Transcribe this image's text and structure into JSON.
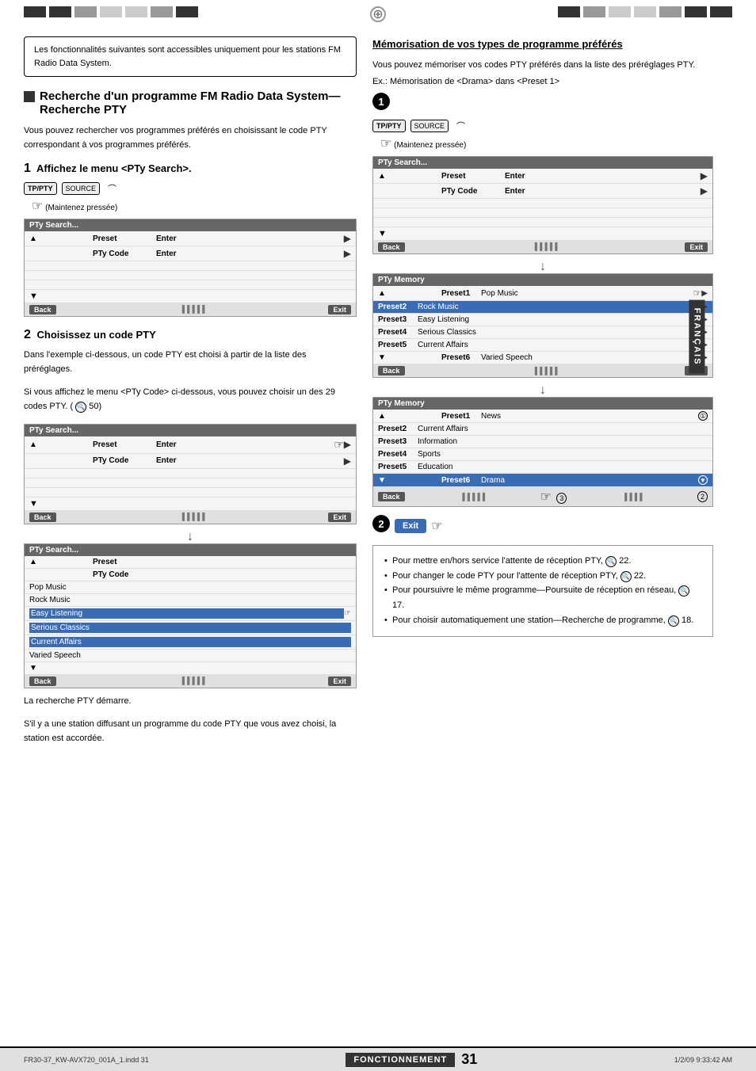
{
  "page": {
    "number": "31",
    "file": "FR30-37_KW-AVX720_001A_1.indd  31",
    "date": "1/2/09  9:33:42 AM",
    "fonctionnement": "FONCTIONNEMENT",
    "francais": "FRANÇAIS"
  },
  "notice": {
    "text": "Les fonctionnalités suivantes sont accessibles uniquement pour les stations FM Radio Data System."
  },
  "left": {
    "section_title": "Recherche d'un programme FM Radio Data System—Recherche PTY",
    "section_desc": "Vous pouvez rechercher vos programmes préférés en choisissant le code PTY correspondant à vos programmes préférés.",
    "step1": {
      "header": "Affichez le menu <PTy Search>.",
      "instruction_label": "(Maintenez pressée)"
    },
    "step2_header": "Choisissez un code PTY",
    "step2_desc1": "Dans l'exemple ci-dessous, un code PTY est choisi à partir de la liste des préréglages.",
    "step2_desc2": "Si vous affichez le menu <PTy Code> ci-dessous, vous pouvez choisir un des 29 codes PTY. (",
    "step2_ref": "50)",
    "result_text1": "La recherche PTY démarre.",
    "result_text2": "S'il y a une station diffusant un programme du code PTY que vous avez choisi, la station est accordée."
  },
  "panels": {
    "pty_search_title": "PTy Search...",
    "pty_memory_title": "PTy Memory",
    "preset_label": "Preset",
    "pty_code_label": "PTy Code",
    "enter_label": "Enter",
    "back_label": "Back",
    "exit_label": "Exit",
    "presets_list1": [
      {
        "name": "Preset1",
        "value": "Pop Music",
        "highlighted": false
      },
      {
        "name": "Preset2",
        "value": "Rock Music",
        "highlighted": false
      },
      {
        "name": "Preset3",
        "value": "Easy Listening",
        "highlighted": true
      },
      {
        "name": "Preset4",
        "value": "Serious Classics",
        "highlighted": false
      },
      {
        "name": "Preset5",
        "value": "Current Affairs",
        "highlighted": false
      },
      {
        "name": "Preset6",
        "value": "Varied Speech",
        "highlighted": false
      }
    ],
    "presets_list2": [
      {
        "name": "Preset1",
        "value": "News",
        "highlighted": false
      },
      {
        "name": "Preset2",
        "value": "Current Affairs",
        "highlighted": false
      },
      {
        "name": "Preset3",
        "value": "Information",
        "highlighted": false
      },
      {
        "name": "Preset4",
        "value": "Sports",
        "highlighted": false
      },
      {
        "name": "Preset5",
        "value": "Education",
        "highlighted": false
      },
      {
        "name": "Preset6",
        "value": "Drama",
        "highlighted": true
      }
    ],
    "pty_search_items": [
      {
        "value": "Pop Music",
        "highlighted": false
      },
      {
        "value": "Rock Music",
        "highlighted": false
      },
      {
        "value": "Easy Listening",
        "highlighted": true
      },
      {
        "value": "Serious Classics",
        "highlighted": false
      },
      {
        "value": "Current Affairs",
        "highlighted": false
      },
      {
        "value": "Varied Speech",
        "highlighted": false
      }
    ]
  },
  "right": {
    "section_title": "Mémorisation de vos types de programme préférés",
    "section_desc": "Vous pouvez mémoriser vos codes PTY préférés dans la liste des préréglages PTY.",
    "example_text": "Ex.:  Mémorisation de <Drama> dans <Preset 1>",
    "step1_label": "1",
    "step2_label": "2",
    "step2_exit": "Exit"
  },
  "notes": {
    "items": [
      "Pour mettre en/hors service l'attente de réception PTY,   22.",
      "Pour changer le code PTY pour l'attente de réception PTY,   22.",
      "Pour poursuivre le même programme—Poursuite de réception en réseau,   17.",
      "Pour choisir automatiquement une station—Recherche de programme,   18."
    ]
  }
}
